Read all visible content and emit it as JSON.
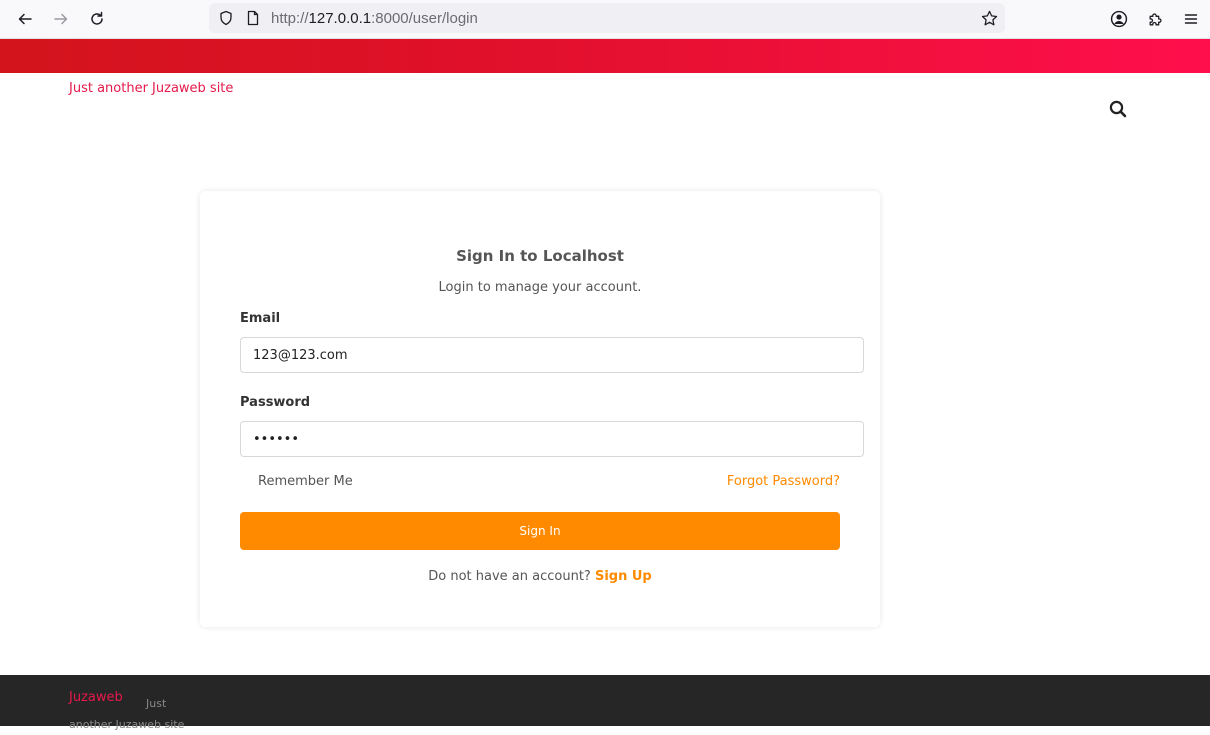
{
  "browser": {
    "url_prefix": "http://",
    "url_host": "127.0.0.1",
    "url_rest": ":8000/user/login"
  },
  "site": {
    "tagline": "Just another Juzaweb site"
  },
  "login": {
    "title": "Sign In to Localhost",
    "subtitle": "Login to manage your account.",
    "email_label": "Email",
    "email_value": "123@123.com",
    "password_label": "Password",
    "password_value": "123456",
    "remember_label": "Remember Me",
    "forgot_label": "Forgot Password?",
    "signin_label": "Sign In",
    "no_account_text": "Do not have an account?",
    "signup_label": "Sign Up"
  },
  "footer": {
    "brand": "Juzaweb",
    "description": "Just another Juzaweb site"
  },
  "colors": {
    "accent": "#ff8a00",
    "brand": "#e5194b",
    "header_band": "#e0102a",
    "footer_bg": "#262626"
  }
}
